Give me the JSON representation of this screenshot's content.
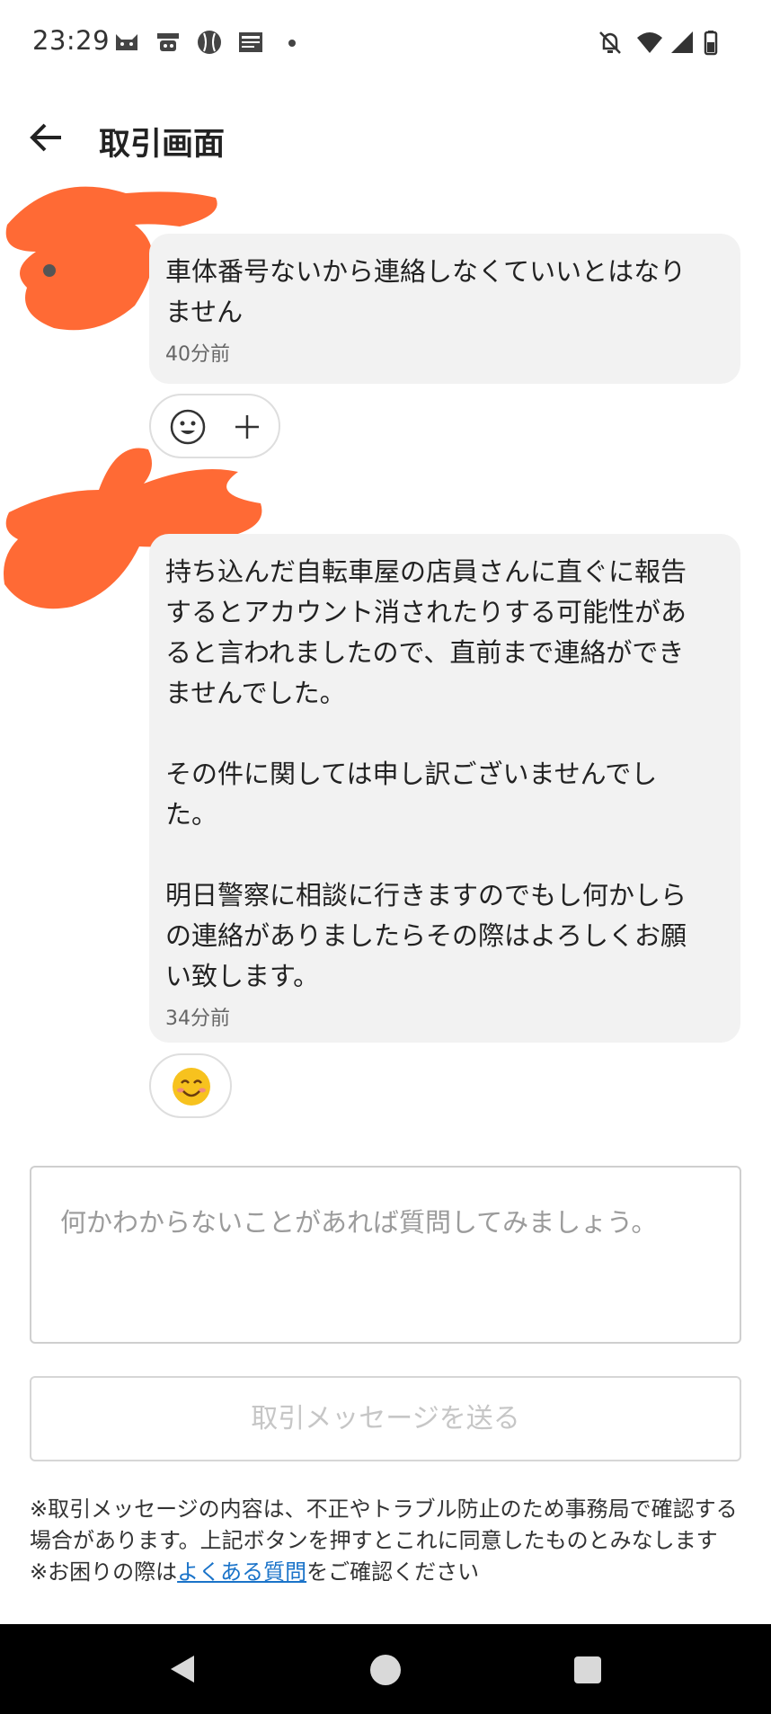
{
  "status_bar": {
    "time": "23:29",
    "left_icons": [
      "cat-notification-icon",
      "app-notification-icon",
      "baseball-icon",
      "news-icon",
      "dot-icon"
    ],
    "right_icons": [
      "notifications-off-icon",
      "wifi-icon",
      "signal-icon",
      "battery-icon"
    ]
  },
  "header": {
    "back_icon": "arrow-left-icon",
    "title": "取引画面"
  },
  "messages": [
    {
      "text": "車体番号ないから連絡しなくていいとはなり\nません",
      "time": "40分前",
      "reactions": [
        "smiley-outline-icon",
        "plus-icon"
      ]
    },
    {
      "text": "持ち込んだ自転車屋の店員さんに直ぐに報告\nするとアカウント消されたりする可能性があ\nると言われましたので、直前まで連絡ができ\nませんでした。\n\nその件に関しては申し訳ございませんでし\nた。\n\n明日警察に相談に行きますのでもし何かしら\nの連絡がありましたらその際はよろしくお願\nい致します。",
      "time": "34分前",
      "reactions": [
        "smiling-face-emoji-icon"
      ]
    }
  ],
  "input": {
    "placeholder": "何かわからないことがあれば質問してみましょう。"
  },
  "send_button": {
    "label": "取引メッセージを送る"
  },
  "notice": {
    "line1": "※取引メッセージの内容は、不正やトラブル防止のため事務局で確認する場合があります。上記ボタンを押すとこれに同意したものとみなします",
    "line2_prefix": "※お困りの際は",
    "line2_link": "よくある質問",
    "line2_suffix": "をご確認ください"
  },
  "nav_bar": {
    "icons": [
      "back-triangle-icon",
      "home-circle-icon",
      "recents-square-icon"
    ]
  },
  "colors": {
    "bubble": "#f2f2f2",
    "scribble": "#ff6a35",
    "link": "#1a73c9",
    "emoji_yellow": "#f7c21e"
  }
}
